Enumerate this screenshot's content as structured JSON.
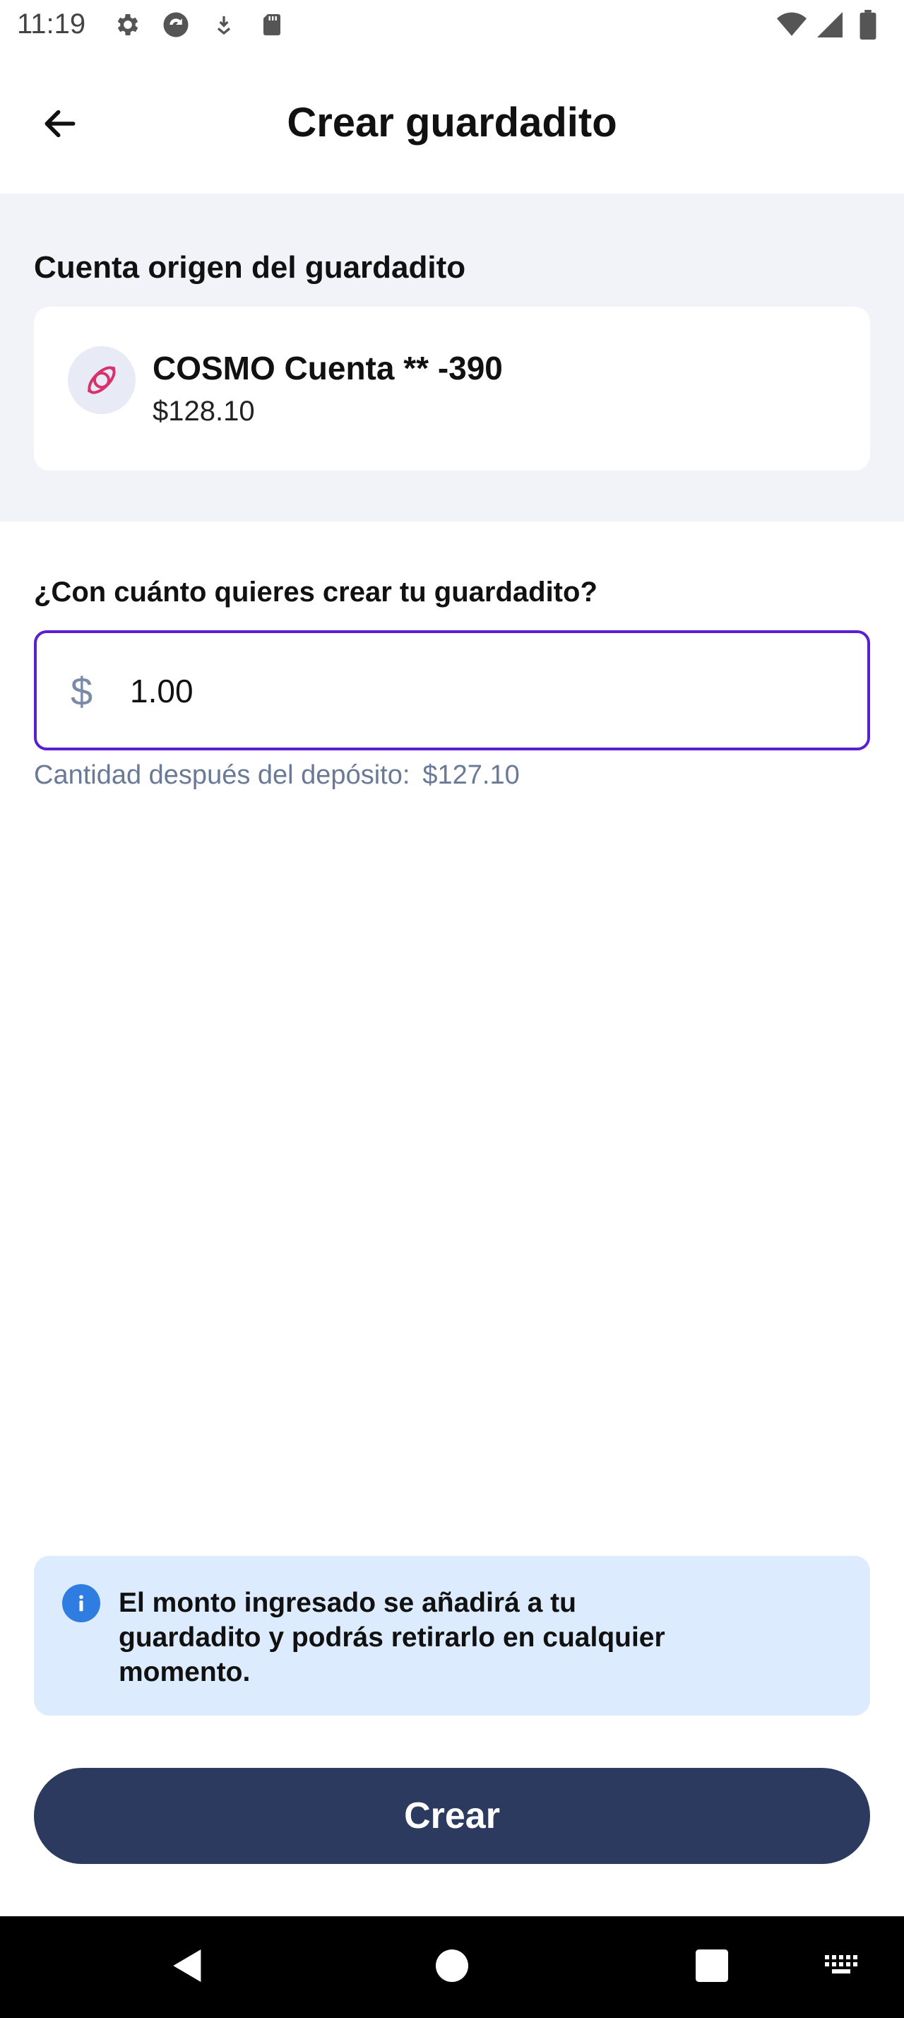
{
  "status_bar": {
    "time": "11:19",
    "left_icons": [
      "gear-icon",
      "sync-icon",
      "download-icon",
      "sd-card-icon"
    ],
    "right_icons": [
      "wifi-icon",
      "cell-signal-icon",
      "battery-icon"
    ]
  },
  "header": {
    "title": "Crear guardadito",
    "back_icon": "arrow-left-icon"
  },
  "source": {
    "section_title": "Cuenta origen del guardadito",
    "account": {
      "name": "COSMO Cuenta ** -390",
      "balance": "$128.10",
      "icon": "cosmo-logo-icon"
    }
  },
  "amount": {
    "label": "¿Con cuánto quieres crear tu guardadito?",
    "currency_symbol": "$",
    "value": "1.00",
    "after_deposit_label": "Cantidad después del depósito:",
    "after_deposit_value": "$127.10"
  },
  "info": {
    "icon": "info-icon",
    "text": "El monto ingresado se añadirá a tu guardadito y podrás retirarlo en cualquier momento."
  },
  "actions": {
    "create_label": "Crear"
  },
  "nav_bar": {
    "buttons": [
      "back-triangle-icon",
      "home-circle-icon",
      "recents-square-icon",
      "keyboard-icon"
    ]
  },
  "colors": {
    "accent_border": "#5a1fd1",
    "button_bg": "#2c3a60",
    "info_bg": "#dcebfd",
    "info_icon": "#2f7de1",
    "section_bg": "#f2f3f8",
    "muted_text": "#6a7a96"
  }
}
